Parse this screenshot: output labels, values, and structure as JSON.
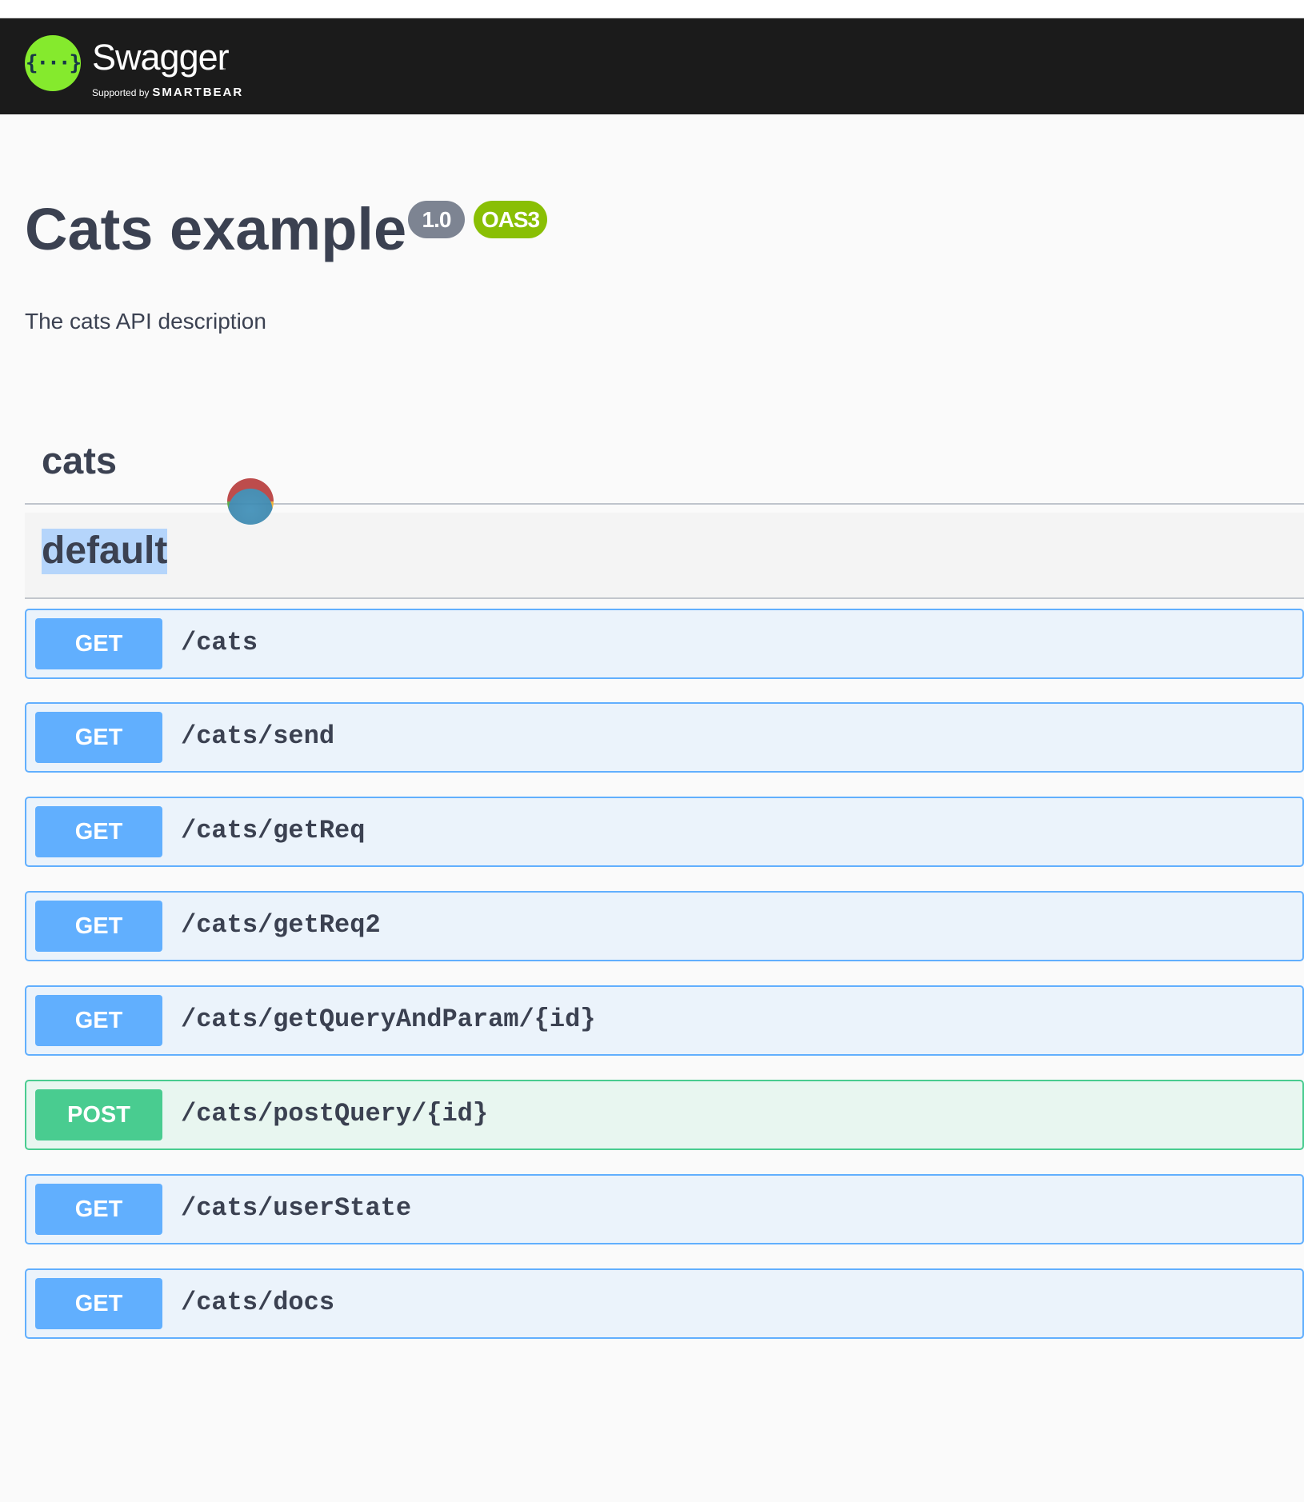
{
  "topbar": {
    "logo_name": "Swagger",
    "logo_tm": "™",
    "supported_by": "Supported by",
    "brand": "SMARTBEAR"
  },
  "info": {
    "title": "Cats example",
    "version": "1.0",
    "oas": "OAS3",
    "description": "The cats API description"
  },
  "section": {
    "heading": "cats"
  },
  "tag": {
    "name": "default"
  },
  "operations": [
    {
      "method": "GET",
      "path": "/cats"
    },
    {
      "method": "GET",
      "path": "/cats/send"
    },
    {
      "method": "GET",
      "path": "/cats/getReq"
    },
    {
      "method": "GET",
      "path": "/cats/getReq2"
    },
    {
      "method": "GET",
      "path": "/cats/getQueryAndParam/{id}"
    },
    {
      "method": "POST",
      "path": "/cats/postQuery/{id}"
    },
    {
      "method": "GET",
      "path": "/cats/userState"
    },
    {
      "method": "GET",
      "path": "/cats/docs"
    }
  ],
  "colors": {
    "get": "#61affe",
    "post": "#49cc90",
    "topbar": "#1b1b1b",
    "logo": "#85ea2d"
  }
}
